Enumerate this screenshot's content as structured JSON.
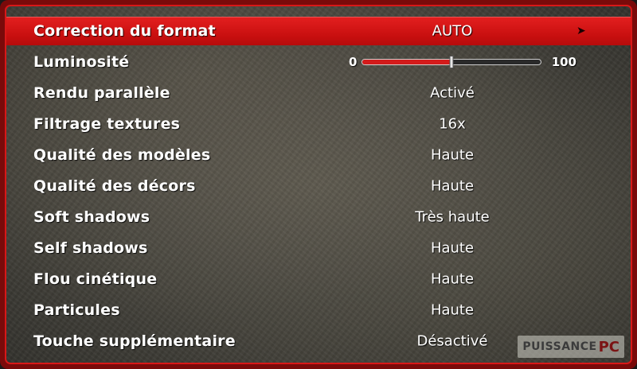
{
  "menu": {
    "items": [
      {
        "label": "Correction du format",
        "value": "AUTO",
        "selected": true,
        "arrow_icon": "chevron-right-icon"
      },
      {
        "label": "Luminosité",
        "slider": {
          "min": "0",
          "max": "100",
          "value_percent": 50
        }
      },
      {
        "label": "Rendu parallèle",
        "value": "Activé"
      },
      {
        "label": "Filtrage textures",
        "value": "16x"
      },
      {
        "label": "Qualité des modèles",
        "value": "Haute"
      },
      {
        "label": "Qualité des décors",
        "value": "Haute"
      },
      {
        "label": "Soft shadows",
        "value": "Très haute"
      },
      {
        "label": "Self shadows",
        "value": "Haute"
      },
      {
        "label": "Flou cinétique",
        "value": "Haute"
      },
      {
        "label": "Particules",
        "value": "Haute"
      },
      {
        "label": "Touche supplémentaire",
        "value": "Désactivé"
      }
    ]
  },
  "watermark": {
    "main": "PUISSANCE",
    "accent": "PC"
  },
  "colors": {
    "accent": "#d81818",
    "frame": "#7a0a0a",
    "text": "#ffffff"
  }
}
